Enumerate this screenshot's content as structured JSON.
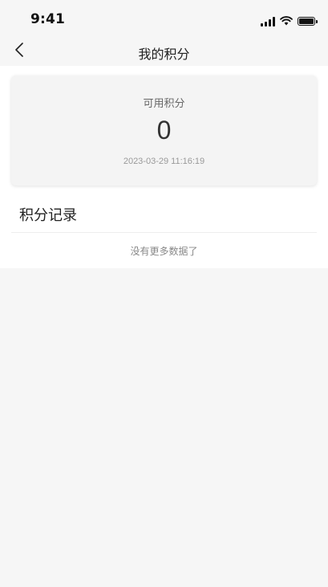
{
  "status_bar": {
    "time": "9:41",
    "icons": [
      "signal-icon",
      "wifi-icon",
      "battery-icon"
    ]
  },
  "nav": {
    "back_icon": "chevron-left-icon",
    "title": "我的积分"
  },
  "points_card": {
    "label": "可用积分",
    "value": "0",
    "timestamp": "2023-03-29 11:16:19"
  },
  "records": {
    "title": "积分记录",
    "empty_message": "没有更多数据了"
  }
}
